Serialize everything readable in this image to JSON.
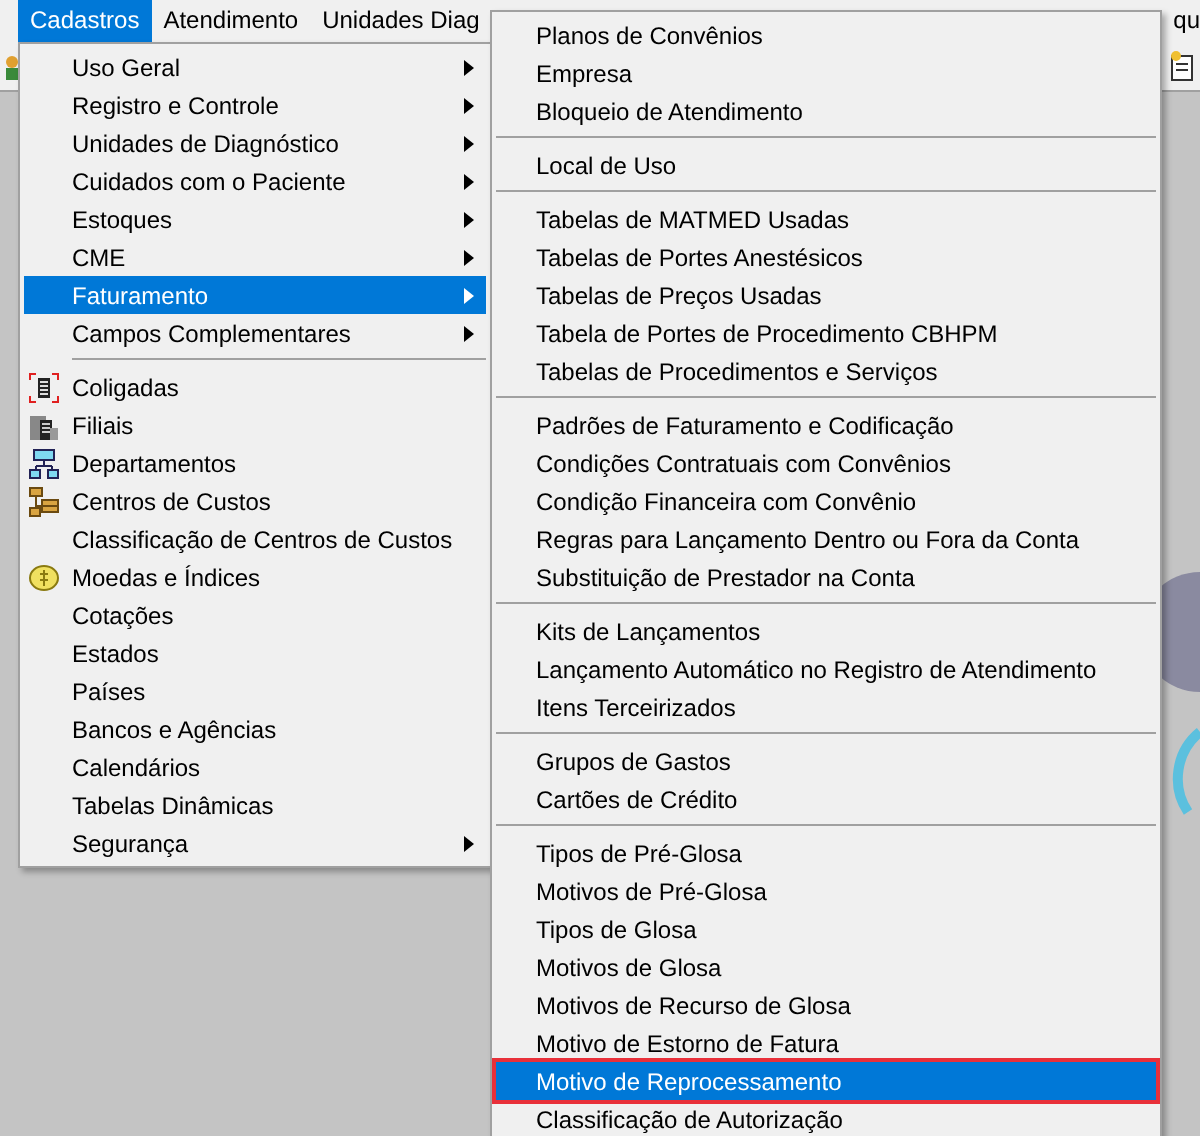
{
  "menubar": [
    {
      "label": "Cadastros",
      "selected": true
    },
    {
      "label": "Atendimento",
      "selected": false
    },
    {
      "label": "Unidades Diag",
      "selected": false
    },
    {
      "label": "qu",
      "selected": false
    }
  ],
  "menu": {
    "groups": [
      [
        {
          "label": "Uso Geral",
          "submenu": true,
          "selected": false
        },
        {
          "label": "Registro e Controle",
          "submenu": true,
          "selected": false
        },
        {
          "label": "Unidades de Diagnóstico",
          "submenu": true,
          "selected": false
        },
        {
          "label": "Cuidados com o Paciente",
          "submenu": true,
          "selected": false
        },
        {
          "label": "Estoques",
          "submenu": true,
          "selected": false
        },
        {
          "label": "CME",
          "submenu": true,
          "selected": false
        },
        {
          "label": "Faturamento",
          "submenu": true,
          "selected": true
        },
        {
          "label": "Campos Complementares",
          "submenu": true,
          "selected": false
        }
      ],
      [
        {
          "label": "Coligadas",
          "kind": "building",
          "submenu": false,
          "selected": false
        },
        {
          "label": "Filiais",
          "kind": "buildings",
          "submenu": false,
          "selected": false
        },
        {
          "label": "Departamentos",
          "kind": "chart",
          "submenu": false,
          "selected": false
        },
        {
          "label": "Centros de Custos",
          "kind": "stack",
          "submenu": false,
          "selected": false
        },
        {
          "label": "Classificação de Centros de Custos",
          "submenu": false,
          "selected": false
        },
        {
          "label": "Moedas e Índices",
          "kind": "coin",
          "submenu": false,
          "selected": false
        },
        {
          "label": "Cotações",
          "submenu": false,
          "selected": false
        },
        {
          "label": "Estados",
          "submenu": false,
          "selected": false
        },
        {
          "label": "Países",
          "submenu": false,
          "selected": false
        },
        {
          "label": "Bancos e Agências",
          "submenu": false,
          "selected": false
        },
        {
          "label": "Calendários",
          "submenu": false,
          "selected": false
        },
        {
          "label": "Tabelas Dinâmicas",
          "submenu": false,
          "selected": false
        },
        {
          "label": "Segurança",
          "submenu": true,
          "selected": false
        }
      ]
    ]
  },
  "submenu": {
    "groups": [
      [
        {
          "label": "Planos de Convênios",
          "selected": false,
          "outlined": false
        },
        {
          "label": "Empresa",
          "selected": false,
          "outlined": false
        },
        {
          "label": "Bloqueio de Atendimento",
          "selected": false,
          "outlined": false
        }
      ],
      [
        {
          "label": "Local de Uso",
          "selected": false,
          "outlined": false
        }
      ],
      [
        {
          "label": "Tabelas de MATMED Usadas",
          "selected": false,
          "outlined": false
        },
        {
          "label": "Tabelas de Portes Anestésicos",
          "selected": false,
          "outlined": false
        },
        {
          "label": "Tabelas de Preços Usadas",
          "selected": false,
          "outlined": false
        },
        {
          "label": "Tabela de Portes de Procedimento CBHPM",
          "selected": false,
          "outlined": false
        },
        {
          "label": "Tabelas de Procedimentos e Serviços",
          "selected": false,
          "outlined": false
        }
      ],
      [
        {
          "label": "Padrões de Faturamento e Codificação",
          "selected": false,
          "outlined": false
        },
        {
          "label": "Condições Contratuais com Convênios",
          "selected": false,
          "outlined": false
        },
        {
          "label": "Condição Financeira com Convênio",
          "selected": false,
          "outlined": false
        },
        {
          "label": "Regras para Lançamento Dentro ou Fora da Conta",
          "selected": false,
          "outlined": false
        },
        {
          "label": "Substituição de Prestador na Conta",
          "selected": false,
          "outlined": false
        }
      ],
      [
        {
          "label": "Kits de Lançamentos",
          "selected": false,
          "outlined": false
        },
        {
          "label": "Lançamento Automático no Registro de Atendimento",
          "selected": false,
          "outlined": false
        },
        {
          "label": "Itens Terceirizados",
          "selected": false,
          "outlined": false
        }
      ],
      [
        {
          "label": "Grupos de Gastos",
          "selected": false,
          "outlined": false
        },
        {
          "label": "Cartões de Crédito",
          "selected": false,
          "outlined": false
        }
      ],
      [
        {
          "label": "Tipos de Pré-Glosa",
          "selected": false,
          "outlined": false
        },
        {
          "label": "Motivos de Pré-Glosa",
          "selected": false,
          "outlined": false
        },
        {
          "label": "Tipos de Glosa",
          "selected": false,
          "outlined": false
        },
        {
          "label": "Motivos de Glosa",
          "selected": false,
          "outlined": false
        },
        {
          "label": "Motivos de Recurso de Glosa",
          "selected": false,
          "outlined": false
        },
        {
          "label": "Motivo de Estorno de Fatura",
          "selected": false,
          "outlined": false
        },
        {
          "label": "Motivo de Reprocessamento",
          "selected": true,
          "outlined": true
        },
        {
          "label": "Classificação de Autorização",
          "selected": false,
          "outlined": false
        }
      ]
    ]
  }
}
